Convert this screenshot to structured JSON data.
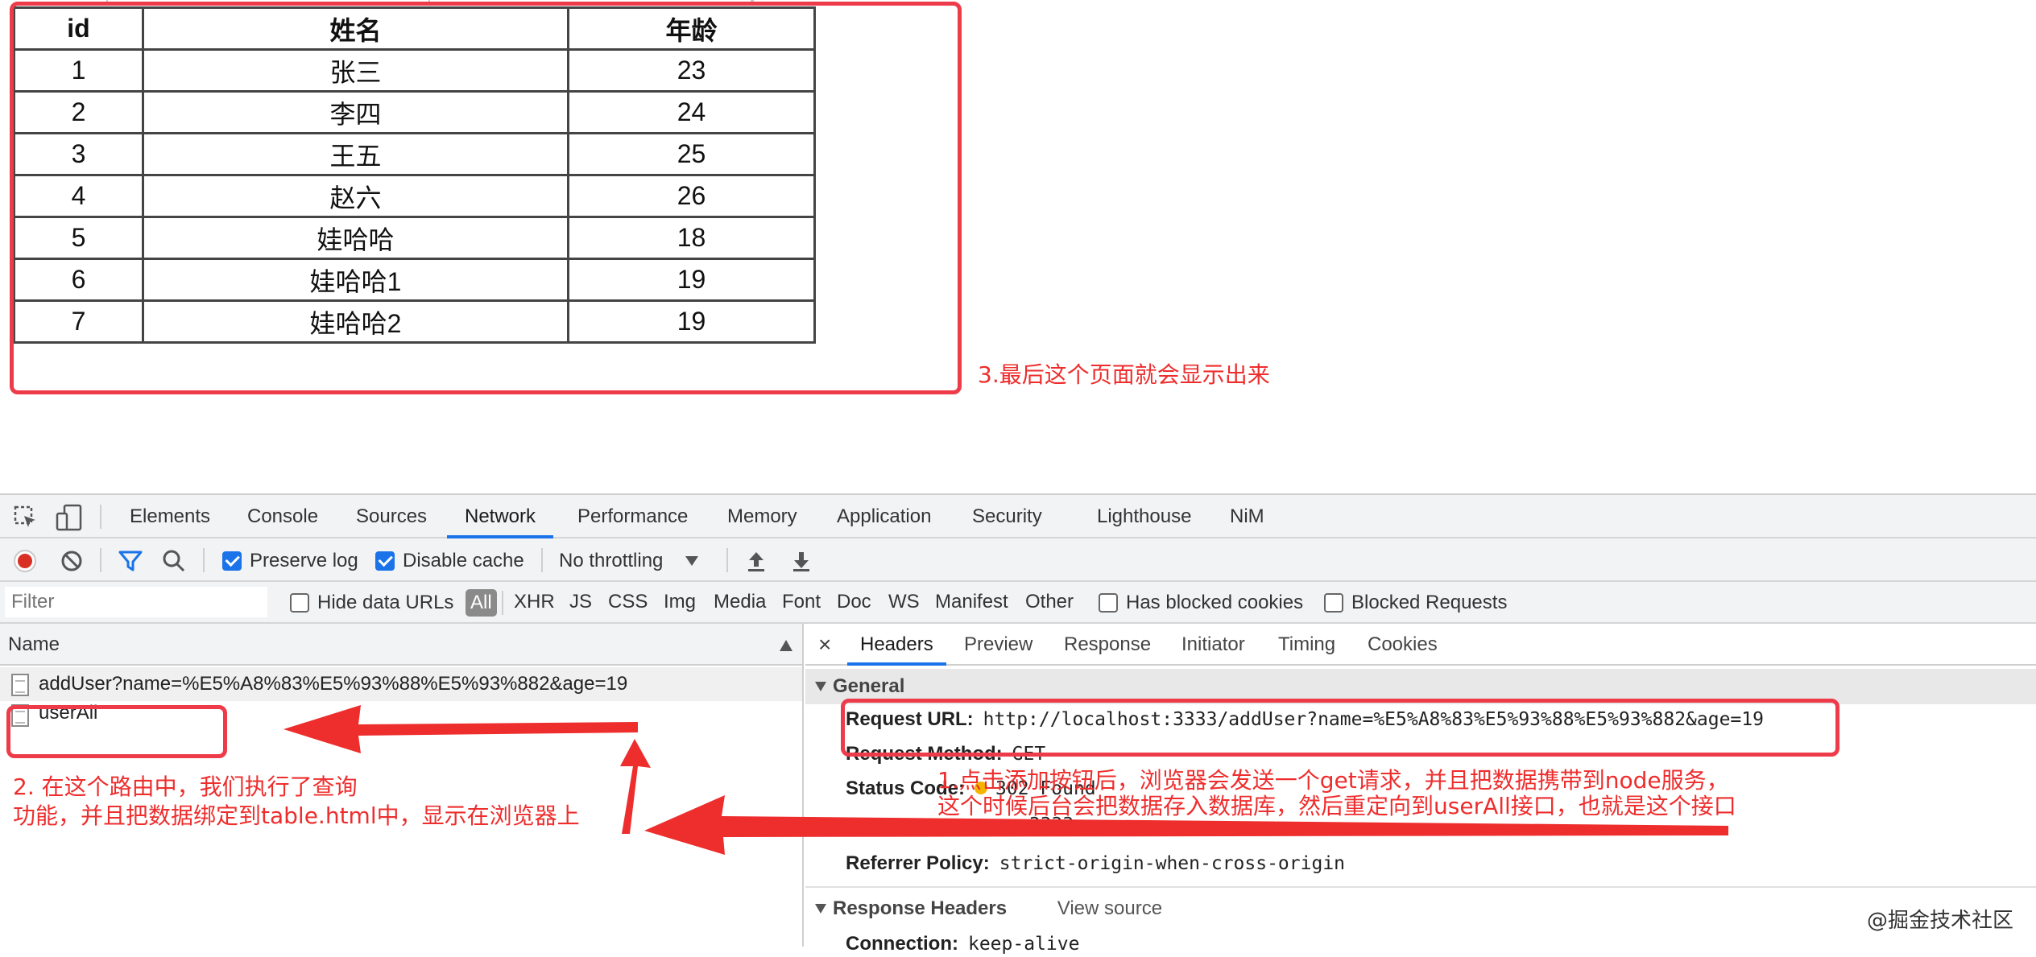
{
  "table": {
    "headers": [
      "id",
      "姓名",
      "年龄"
    ],
    "rows": [
      [
        "1",
        "张三",
        "23"
      ],
      [
        "2",
        "李四",
        "24"
      ],
      [
        "3",
        "王五",
        "25"
      ],
      [
        "4",
        "赵六",
        "26"
      ],
      [
        "5",
        "娃哈哈",
        "18"
      ],
      [
        "6",
        "娃哈哈1",
        "19"
      ],
      [
        "7",
        "娃哈哈2",
        "19"
      ]
    ]
  },
  "annotations": {
    "step3": "3.最后这个页面就会显示出来",
    "step2_line1": "2. 在这个路由中，我们执行了查询",
    "step2_line2": "功能，并且把数据绑定到table.html中，显示在浏览器上",
    "step1_line1": "1.点击添加按钮后，浏览器会发送一个get请求，并且把数据携带到node服务，",
    "step1_line2": "这个时候后台会把数据存入数据库，然后重定向到userAll接口，也就是这个接口",
    "color": "#ee2d2d"
  },
  "devtools": {
    "tabs": [
      "Elements",
      "Console",
      "Sources",
      "Network",
      "Performance",
      "Memory",
      "Application",
      "Security",
      "Lighthouse",
      "NiM"
    ],
    "active_tab": "Network",
    "toolbar": {
      "preserve_log": "Preserve log",
      "disable_cache": "Disable cache",
      "throttling": "No throttling"
    },
    "filter": {
      "placeholder": "Filter",
      "hide_data_urls": "Hide data URLs",
      "all": "All",
      "types": [
        "XHR",
        "JS",
        "CSS",
        "Img",
        "Media",
        "Font",
        "Doc",
        "WS",
        "Manifest",
        "Other"
      ],
      "has_blocked_cookies": "Has blocked cookies",
      "blocked_requests": "Blocked Requests"
    },
    "requests": {
      "column": "Name",
      "items": [
        "addUser?name=%E5%A8%83%E5%93%88%E5%93%882&age=19",
        "userAll"
      ]
    },
    "detail": {
      "close": "×",
      "tabs": [
        "Headers",
        "Preview",
        "Response",
        "Initiator",
        "Timing",
        "Cookies"
      ],
      "active_tab": "Headers",
      "general_title": "General",
      "request_url_label": "Request URL:",
      "request_url": "http://localhost:3333/addUser?name=%E5%A8%83%E5%93%88%E5%93%882&age=19",
      "request_method_label": "Request Method:",
      "request_method": "GET",
      "status_code_label": "Status Code:",
      "status_code": "302 Found",
      "remote_address_fragment": ":3333",
      "referrer_policy_label": "Referrer Policy:",
      "referrer_policy": "strict-origin-when-cross-origin",
      "response_headers_title": "Response Headers",
      "view_source": "View source",
      "connection_label": "Connection:",
      "connection": "keep-alive"
    }
  },
  "watermark": "@掘金技术社区"
}
